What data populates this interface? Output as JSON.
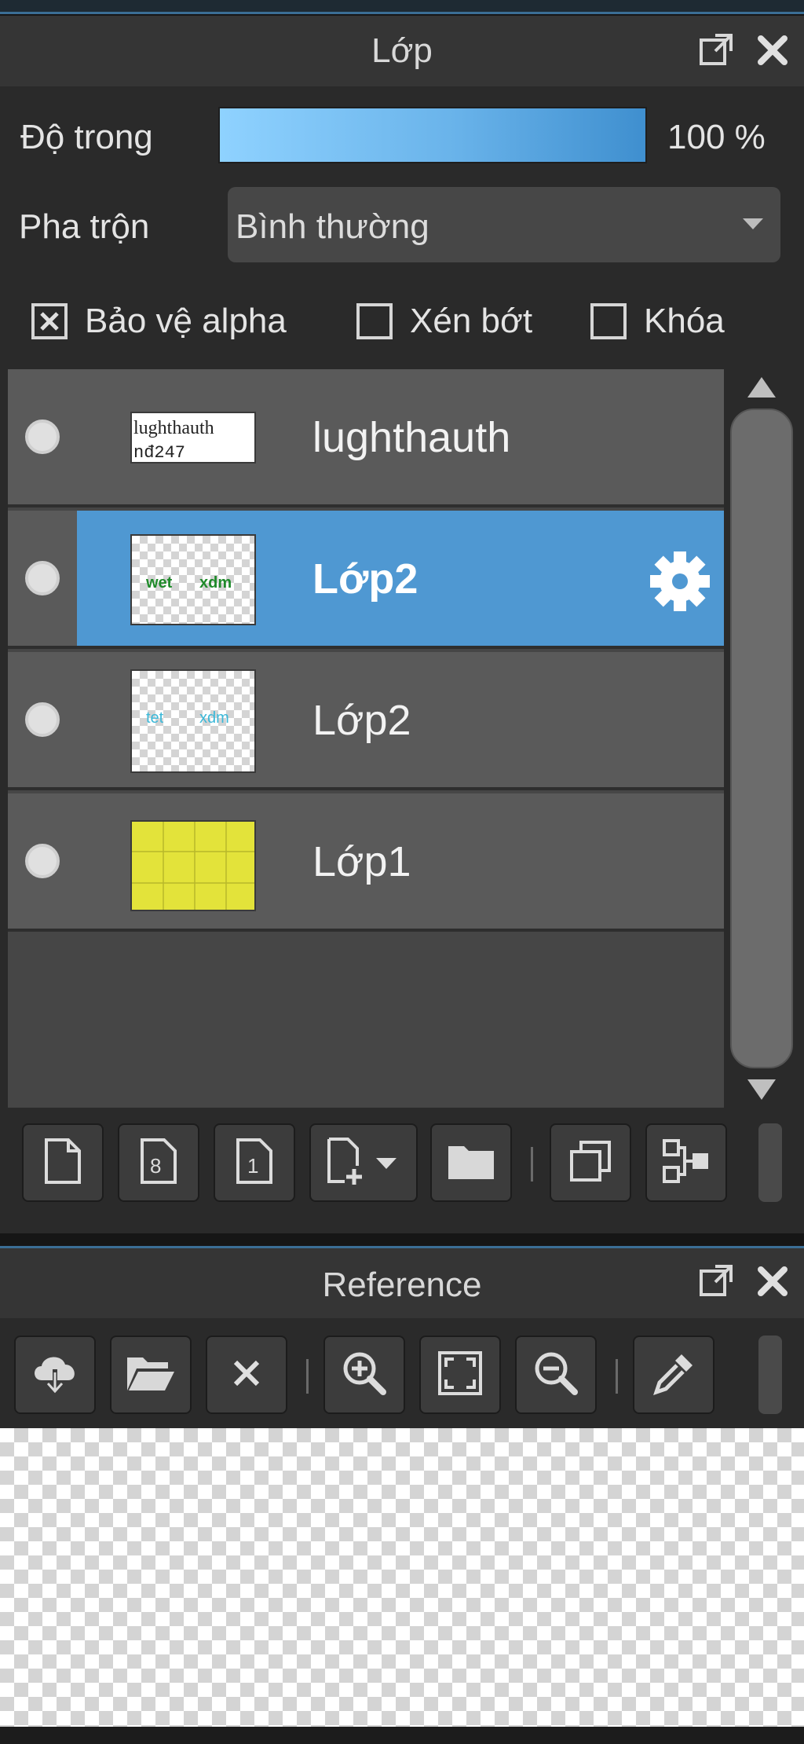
{
  "layer_panel": {
    "title": "Lớp",
    "opacity": {
      "label": "Độ trong",
      "value_text": "100 %",
      "level": 1.0
    },
    "blend": {
      "label": "Pha trộn",
      "selected": "Bình thường"
    },
    "checkboxes": [
      {
        "label": "Bảo vệ alpha",
        "checked": true
      },
      {
        "label": "Xén bớt",
        "checked": false
      },
      {
        "label": "Khóa",
        "checked": false
      }
    ],
    "layers": [
      {
        "name": "lughthauth",
        "thumb_text": "lughthauth\nnđ247",
        "selected": false
      },
      {
        "name": "Lớp2",
        "thumb_text": "wet xdm",
        "selected": true
      },
      {
        "name": "Lớp2",
        "thumb_text": "tet xdm",
        "selected": false
      },
      {
        "name": "Lớp1",
        "thumb_text": "",
        "selected": false
      }
    ],
    "toolbar": [
      {
        "name": "new-layer-icon"
      },
      {
        "name": "new-8bit-layer-icon",
        "text": "8"
      },
      {
        "name": "new-1bit-layer-icon",
        "text": "1"
      },
      {
        "name": "add-layer-menu-icon"
      },
      {
        "name": "folder-icon"
      },
      {
        "name": "duplicate-layer-icon"
      },
      {
        "name": "merge-layer-icon"
      }
    ]
  },
  "reference_panel": {
    "title": "Reference",
    "toolbar": [
      {
        "name": "import-icon"
      },
      {
        "name": "open-folder-icon"
      },
      {
        "name": "close-icon"
      },
      {
        "name": "zoom-in-icon"
      },
      {
        "name": "fit-icon"
      },
      {
        "name": "zoom-out-icon"
      },
      {
        "name": "eyedropper-icon"
      }
    ]
  },
  "colors": {
    "selected_row": "#4f98d2",
    "opacity_bar": "#69b3ea",
    "panel_bg": "#2a2a2a",
    "row_bg": "#5a5a5a"
  }
}
